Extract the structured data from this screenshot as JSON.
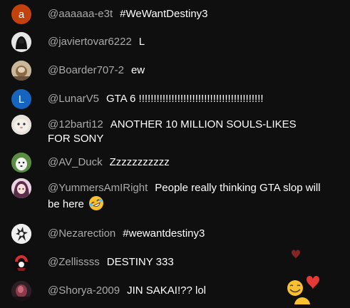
{
  "messages": [
    {
      "author": "@aaaaaa-e3t",
      "text": "#WeWantDestiny3",
      "avatar_letter": "a",
      "avatar_color": "#c2410c"
    },
    {
      "author": "@javiertovar6222",
      "text": "L",
      "avatar_icon": "hooded-figure-icon"
    },
    {
      "author": "@Boarder707-2",
      "text": "ew",
      "avatar_icon": "photo-avatar-icon"
    },
    {
      "author": "@LunarV5",
      "text": "GTA 6 !!!!!!!!!!!!!!!!!!!!!!!!!!!!!!!!!!!!!!!!!!",
      "avatar_letter": "L",
      "avatar_color": "#1565c0"
    },
    {
      "author": "@12barti12",
      "text": "ANOTHER 10 MILLION SOULS-LIKES FOR SONY",
      "avatar_icon": "cat-face-icon"
    },
    {
      "author": "@AV_Duck",
      "text": "Zzzzzzzzzzz",
      "avatar_icon": "dog-photo-icon"
    },
    {
      "author": "@YummersAmIRight",
      "text": "People really thinking GTA slop will be here",
      "avatar_icon": "anime-girl-icon",
      "trailing_emoji": "rolling-on-floor-laughing-icon"
    },
    {
      "author": "@Nezarection",
      "text": "#wewantdestiny3",
      "avatar_icon": "sketch-avatar-icon"
    },
    {
      "author": "@Zellissss",
      "text": "DESTINY 333",
      "avatar_icon": "red-ring-icon"
    },
    {
      "author": "@Shorya-2009",
      "text": "JIN SAKAI!?? lol",
      "avatar_icon": "dark-portrait-icon"
    }
  ],
  "reactions": [
    "heart-icon",
    "heart-icon",
    "smiling-face-icon",
    "smiling-face-icon"
  ],
  "colors": {
    "background": "#0f0f0f",
    "author": "#aaaaaa",
    "text": "#ffffff",
    "heart": "#e53935"
  }
}
